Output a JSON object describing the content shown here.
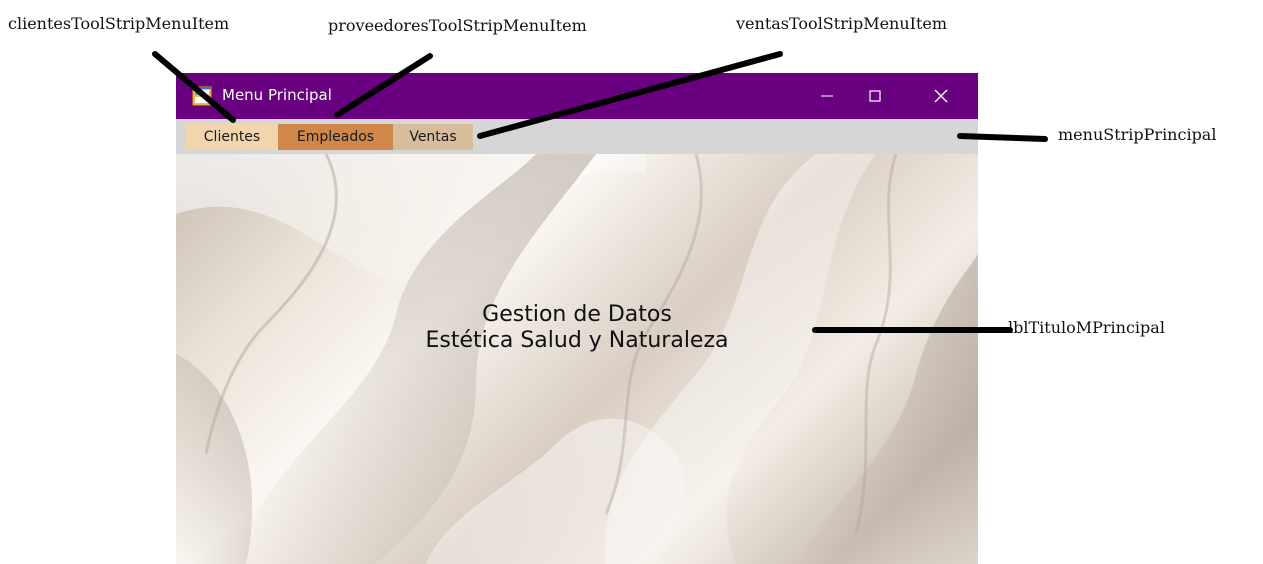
{
  "annotations": {
    "clientes_item": "clientesToolStripMenuItem",
    "proveedores_item": "proveedoresToolStripMenuItem",
    "ventas_item": "ventasToolStripMenuItem",
    "menu_strip": "menuStripPrincipal",
    "title_label": "lblTituloMPrincipal"
  },
  "window": {
    "title": "Menu Principal",
    "titlebar_color": "#68007f",
    "minimize_glyph": "—",
    "maximize_glyph": "☐",
    "close_glyph": "✕"
  },
  "menu": {
    "items": [
      {
        "label": "Clientes",
        "color": "#f1d5ad"
      },
      {
        "label": "Empleados",
        "color": "#d0874a"
      },
      {
        "label": "Ventas",
        "color": "#d7bd9b"
      }
    ]
  },
  "main": {
    "title_line1": "Gestion de Datos",
    "title_line2": "Estética Salud y Naturaleza"
  },
  "icons": [
    "app-form-icon",
    "minimize-icon",
    "maximize-icon",
    "close-icon"
  ]
}
